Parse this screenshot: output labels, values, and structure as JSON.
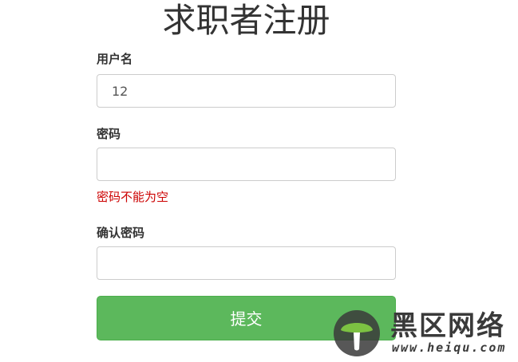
{
  "page": {
    "title": "求职者注册"
  },
  "form": {
    "username": {
      "label": "用户名",
      "value": "12",
      "placeholder": ""
    },
    "password": {
      "label": "密码",
      "value": "",
      "placeholder": "",
      "error": "密码不能为空"
    },
    "confirm_password": {
      "label": "确认密码",
      "value": "",
      "placeholder": ""
    },
    "submit_label": "提交"
  },
  "watermark": {
    "name": "黑区网络",
    "url": "www.heiqu.com",
    "logo_icon": "mushroom-logo-icon"
  },
  "colors": {
    "primary_button": "#5cb85c",
    "error_text": "#cc0000",
    "title_text": "#333333",
    "input_border": "#cccccc"
  }
}
